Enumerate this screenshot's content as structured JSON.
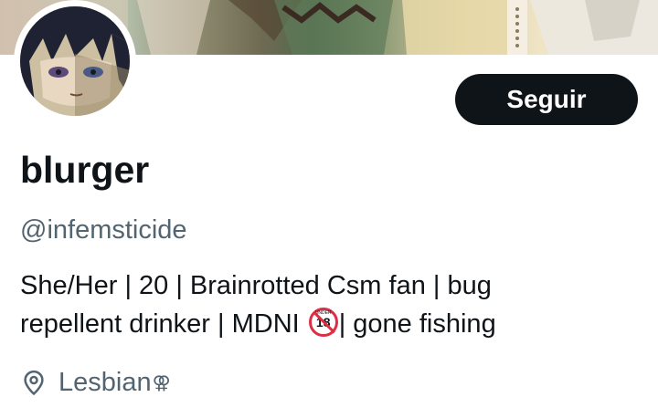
{
  "profile": {
    "display_name": "blurger",
    "handle": "@infemsticide",
    "follow_label": "Seguir",
    "bio_line1": "She/Her | 20 | Brainrotted Csm fan | bug",
    "bio_line2_a": "repellent drinker | MDNI",
    "bio_line2_b": "| gone fishing",
    "badge_number": "18",
    "badge_under": "UNDER",
    "location": "Lesbian",
    "location_symbol": "⚢"
  },
  "icons": {
    "location": "location-pin-icon",
    "age_badge": "no-under-18-icon"
  },
  "colors": {
    "text_primary": "#0f1419",
    "text_secondary": "#536471",
    "button_bg": "#0f1419",
    "badge_red": "#dd2e44"
  }
}
